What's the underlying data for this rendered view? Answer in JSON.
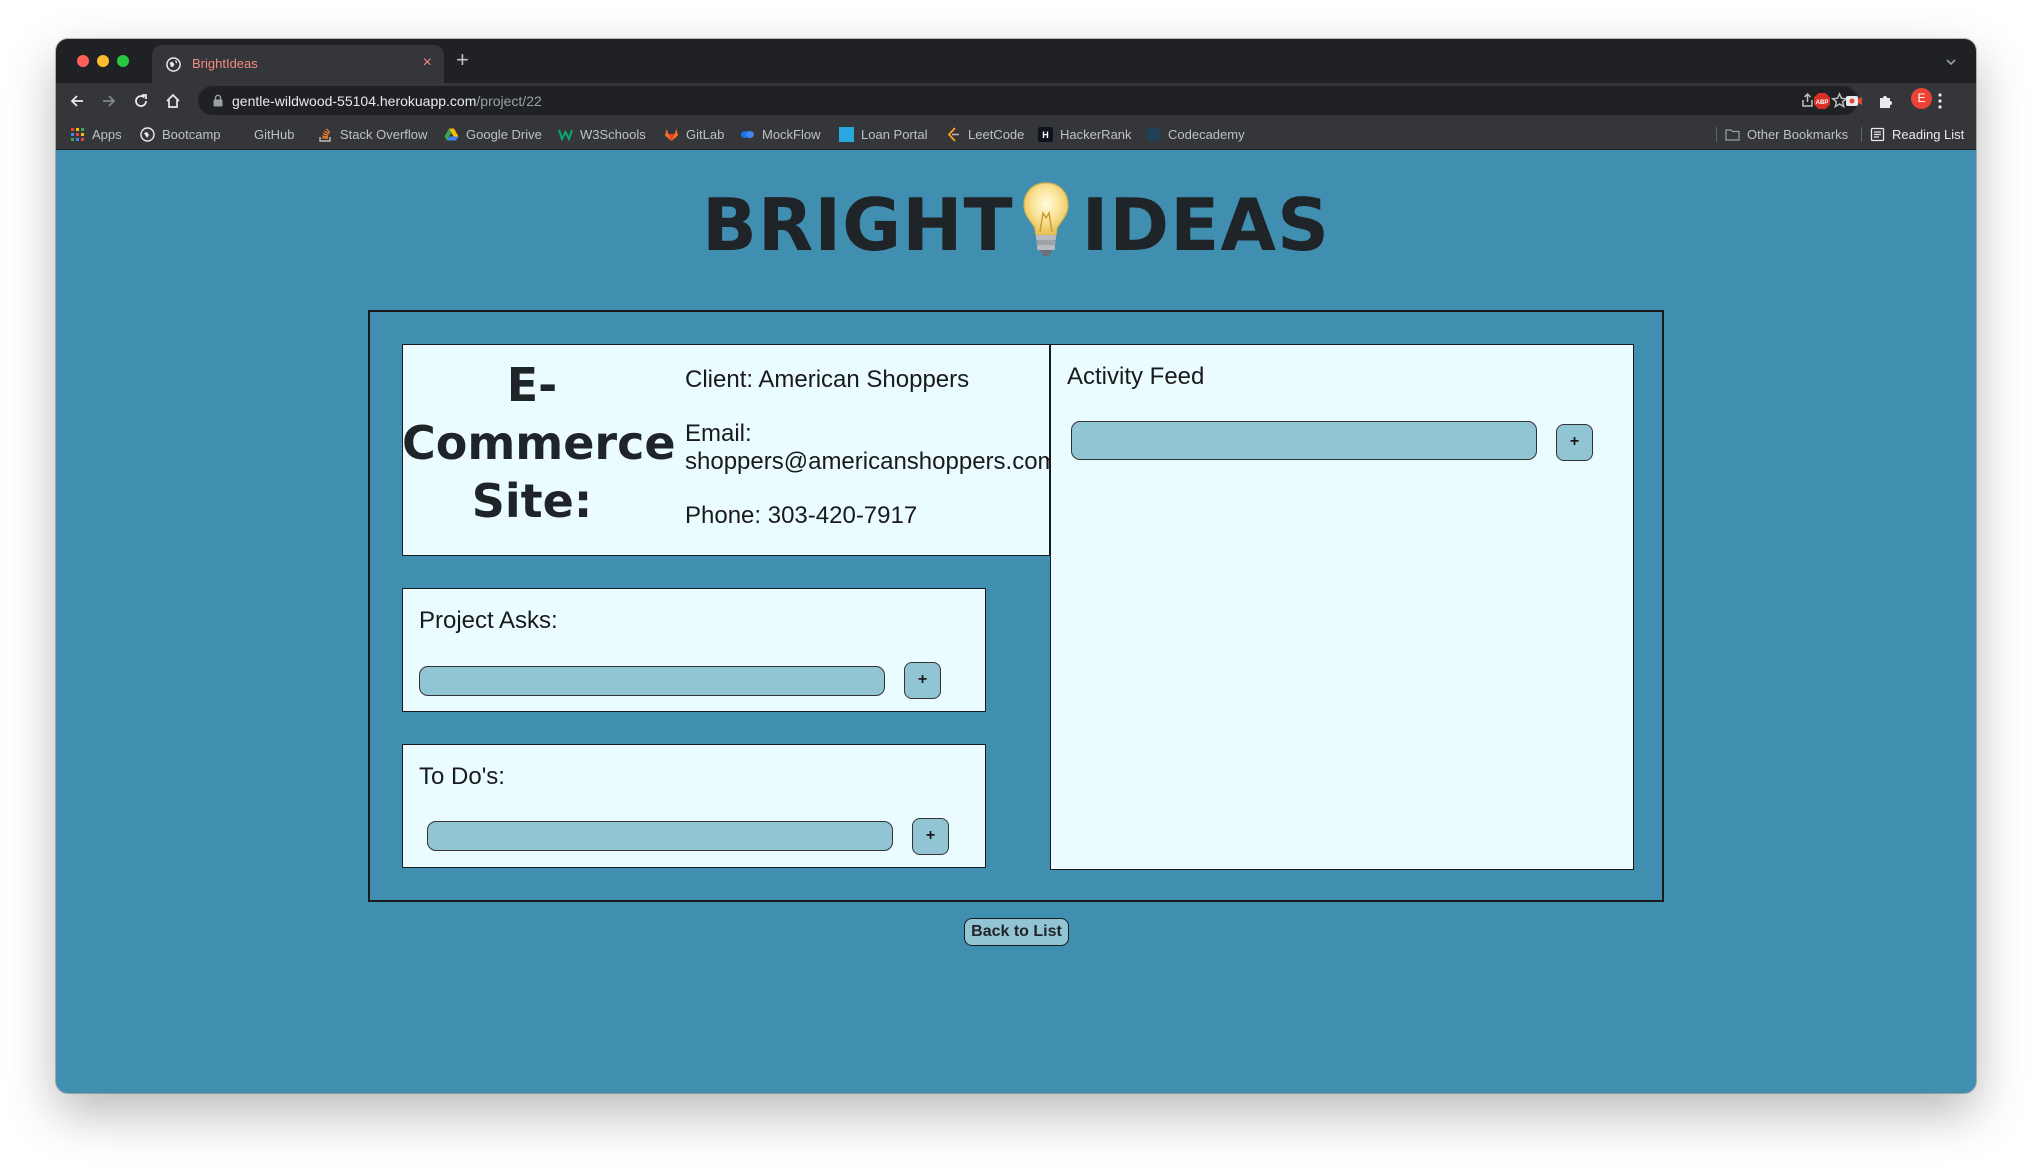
{
  "browser": {
    "tab_title": "BrightIdeas",
    "tab_close": "×",
    "new_tab": "+",
    "url_host": "gentle-wildwood-55104.herokuapp.com",
    "url_path": "/project/22",
    "profile_initial": "E",
    "bookmarks": [
      {
        "label": "Apps",
        "icon": "apps-grid-icon"
      },
      {
        "label": "Bootcamp",
        "icon": "bootcamp-icon"
      },
      {
        "label": "GitHub",
        "icon": "github-icon"
      },
      {
        "label": "Stack Overflow",
        "icon": "stackoverflow-icon"
      },
      {
        "label": "Google Drive",
        "icon": "google-drive-icon"
      },
      {
        "label": "W3Schools",
        "icon": "w3schools-icon"
      },
      {
        "label": "GitLab",
        "icon": "gitlab-icon"
      },
      {
        "label": "MockFlow",
        "icon": "mockflow-icon"
      },
      {
        "label": "Loan Portal",
        "icon": "loan-portal-icon"
      },
      {
        "label": "LeetCode",
        "icon": "leetcode-icon"
      },
      {
        "label": "HackerRank",
        "icon": "hackerrank-icon"
      },
      {
        "label": "Codecademy",
        "icon": "codecademy-icon"
      }
    ],
    "other_bookmarks": "Other Bookmarks",
    "reading_list": "Reading List"
  },
  "page": {
    "logo_left": "BRIGHT",
    "logo_right": "IDEAS",
    "project": {
      "title": "E-Commerce Site:",
      "client": "Client: American Shoppers",
      "email_label": "Email:",
      "email_value": "shoppers@americanshoppers.com",
      "phone": "Phone: 303-420-7917"
    },
    "asks": {
      "heading": "Project Asks:",
      "add_label": "+"
    },
    "todos": {
      "heading": "To Do's:",
      "add_label": "+"
    },
    "feed": {
      "heading": "Activity Feed",
      "add_label": "+"
    },
    "back_button": "Back to List"
  },
  "colors": {
    "page_background": "#418fb0",
    "card_background": "#eafcff",
    "input_background": "#92c5d4",
    "text_dark": "#1f2428"
  }
}
